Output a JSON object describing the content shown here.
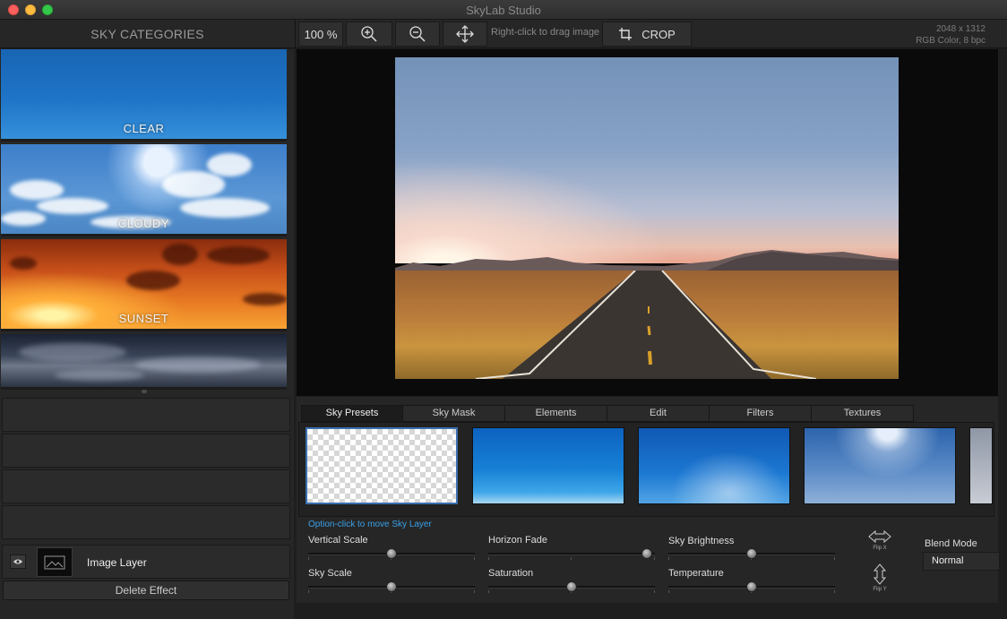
{
  "window": {
    "title": "SkyLab Studio"
  },
  "toolbar": {
    "categories_title": "SKY CATEGORIES",
    "zoom_value": "100 %",
    "drag_hint": "Right-click to drag image",
    "crop_label": "CROP",
    "image_size": "2048 x 1312",
    "image_mode": "RGB Color, 8 bpc"
  },
  "categories": [
    {
      "label": "CLEAR"
    },
    {
      "label": "CLOUDY"
    },
    {
      "label": "SUNSET"
    },
    {
      "label": ""
    }
  ],
  "layers": {
    "image_layer_label": "Image Layer",
    "delete_effect_label": "Delete Effect"
  },
  "tabs": [
    "Sky Presets",
    "Sky Mask",
    "Elements",
    "Edit",
    "Filters",
    "Textures"
  ],
  "active_tab": "Sky Presets",
  "presets_hint": "Option-click to move Sky Layer",
  "sliders": {
    "vertical_scale": {
      "label": "Vertical Scale",
      "value": 0.5
    },
    "horizon_fade": {
      "label": "Horizon Fade",
      "value": 0.95
    },
    "sky_brightness": {
      "label": "Sky Brightness",
      "value": 0.5
    },
    "sky_scale": {
      "label": "Sky Scale",
      "value": 0.5
    },
    "saturation": {
      "label": "Saturation",
      "value": 0.5
    },
    "temperature": {
      "label": "Temperature",
      "value": 0.5
    }
  },
  "flip": {
    "x_label": "Flip X",
    "y_label": "Flip Y"
  },
  "blend": {
    "label": "Blend Mode",
    "value": "Normal"
  },
  "colors": {
    "accent": "#3aa0e8",
    "background": "#1e1e1e",
    "panel": "#262626"
  }
}
